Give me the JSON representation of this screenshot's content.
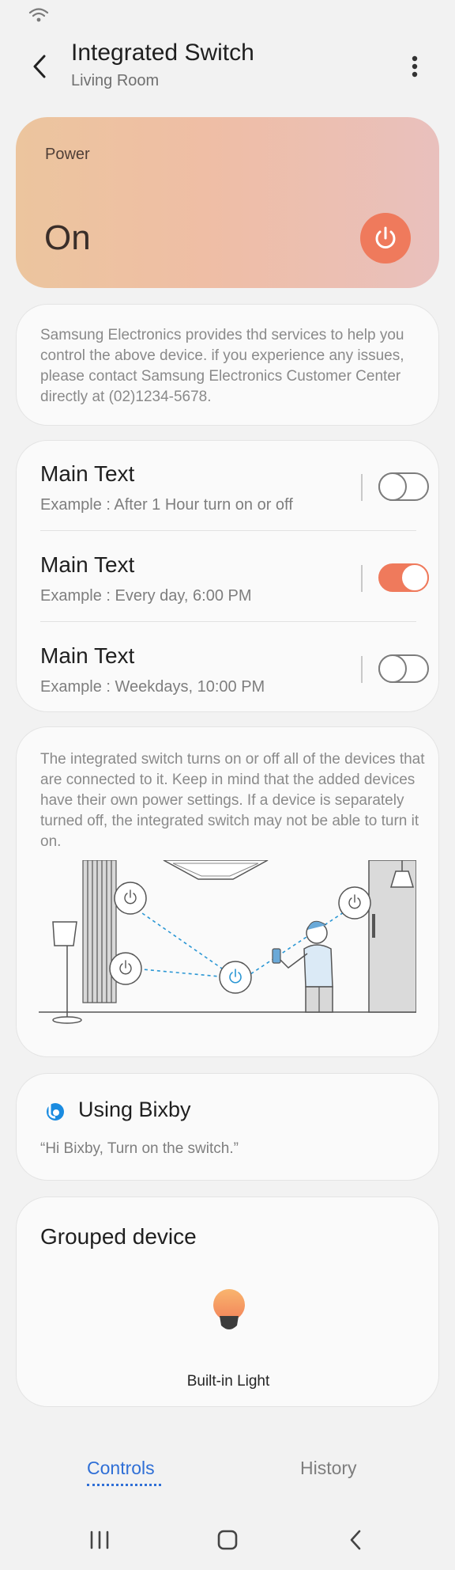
{
  "header": {
    "title": "Integrated Switch",
    "subtitle": "Living Room"
  },
  "power": {
    "label": "Power",
    "state": "On",
    "accent": "#ef7a5c"
  },
  "notice": "Samsung Electronics provides thd services to help you control the above device. if you experience any issues, please contact Samsung Electronics Customer Center directly at (02)1234-5678.",
  "schedules": [
    {
      "main": "Main Text",
      "sub": "Example : After 1 Hour turn on or off",
      "enabled": false
    },
    {
      "main": "Main Text",
      "sub": "Example : Every day, 6:00 PM",
      "enabled": true
    },
    {
      "main": "Main Text",
      "sub": "Example : Weekdays, 10:00 PM",
      "enabled": false
    }
  ],
  "description": "The integrated switch turns on or off all of the devices that are connected to it. Keep in mind that the added devices have their own power settings. If a device is separately turned off, the integrated switch may not be able to turn it on.",
  "bixby": {
    "title": "Using Bixby",
    "quote": "“Hi Bixby, Turn on the switch.”"
  },
  "grouped": {
    "title": "Grouped device",
    "device_label": "Built-in Light"
  },
  "tabs": {
    "controls": "Controls",
    "history": "History",
    "active": "Controls",
    "active_color": "#2f6fd6"
  },
  "icons": {
    "status": "wifi-icon",
    "back": "back-arrow-icon",
    "more": "more-vertical-icon",
    "power": "power-icon",
    "bixby": "bixby-logo-icon",
    "device": "light-bulb-icon",
    "nav": [
      "recent-apps-icon",
      "home-icon",
      "back-nav-icon"
    ]
  }
}
